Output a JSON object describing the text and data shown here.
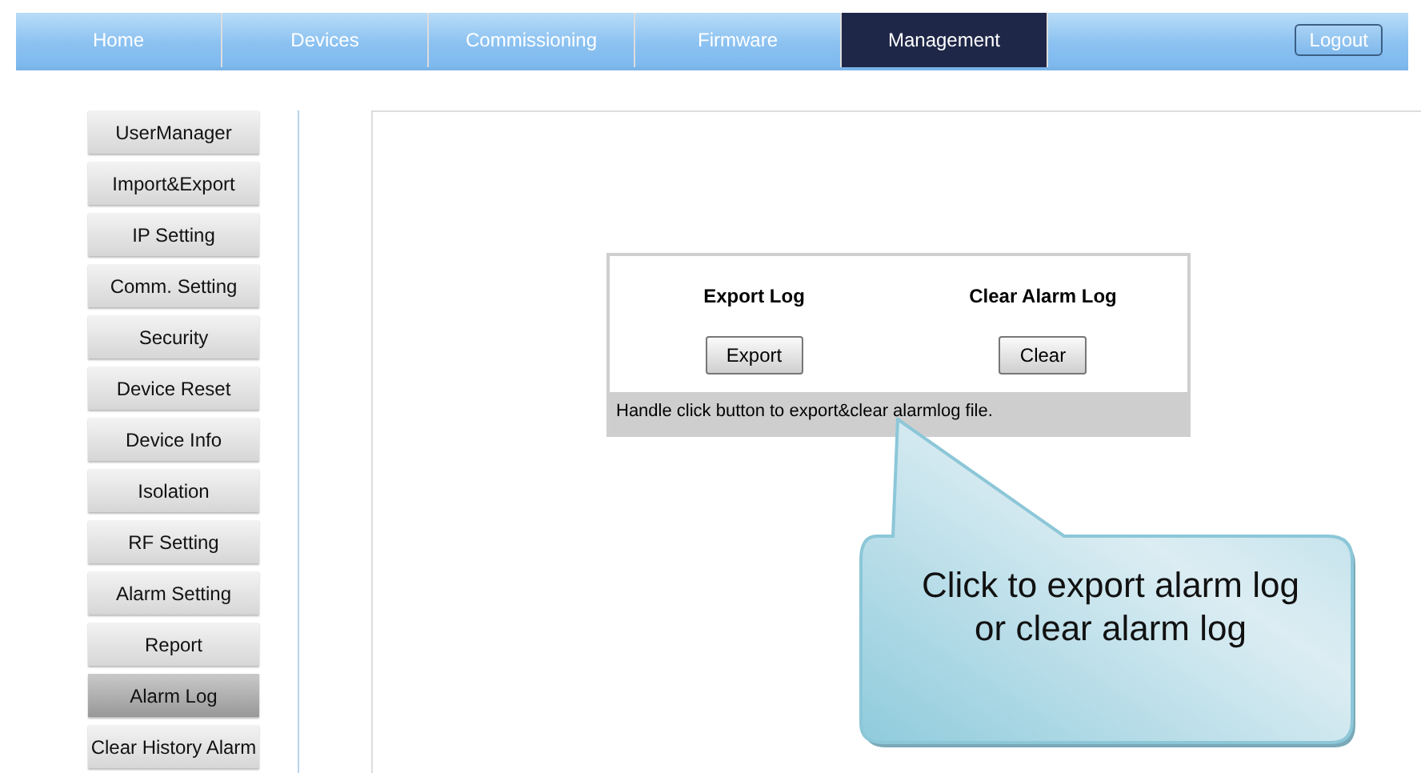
{
  "nav": {
    "tabs": [
      {
        "label": "Home",
        "selected": false
      },
      {
        "label": "Devices",
        "selected": false
      },
      {
        "label": "Commissioning",
        "selected": false
      },
      {
        "label": "Firmware",
        "selected": false
      },
      {
        "label": "Management",
        "selected": true
      }
    ],
    "logout": "Logout"
  },
  "sidebar": {
    "items": [
      {
        "label": "UserManager",
        "selected": false
      },
      {
        "label": "Import&Export",
        "selected": false
      },
      {
        "label": "IP Setting",
        "selected": false
      },
      {
        "label": "Comm. Setting",
        "selected": false
      },
      {
        "label": "Security",
        "selected": false
      },
      {
        "label": "Device Reset",
        "selected": false
      },
      {
        "label": "Device Info",
        "selected": false
      },
      {
        "label": "Isolation",
        "selected": false
      },
      {
        "label": "RF Setting",
        "selected": false
      },
      {
        "label": "Alarm Setting",
        "selected": false
      },
      {
        "label": "Report",
        "selected": false
      },
      {
        "label": "Alarm Log",
        "selected": true
      },
      {
        "label": "Clear History Alarm",
        "selected": false
      }
    ]
  },
  "log_panel": {
    "sections": [
      {
        "title": "Export Log",
        "button": "Export"
      },
      {
        "title": "Clear Alarm Log",
        "button": "Clear"
      }
    ],
    "hint": "Handle click button to export&clear alarmlog file."
  },
  "callout": {
    "text": "Click to export alarm log or clear alarm log"
  }
}
